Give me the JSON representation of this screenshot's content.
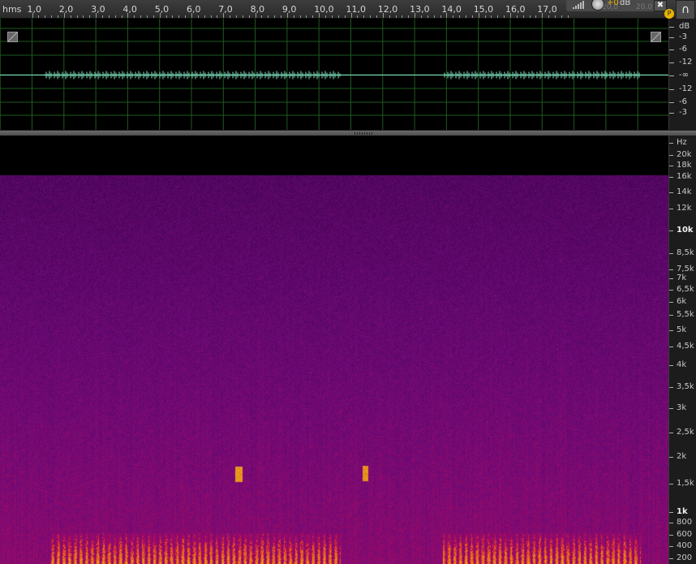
{
  "ruler": {
    "unit": "hms",
    "ticks": [
      "1,0",
      "2,0",
      "3,0",
      "4,0",
      "5,0",
      "6,0",
      "7,0",
      "8,0",
      "9,0",
      "10,0",
      "11,0",
      "12,0",
      "13,0",
      "14,0",
      "15,0",
      "16,0",
      "17,0"
    ]
  },
  "controls": {
    "volume_value": "+0",
    "volume_unit": "dB",
    "ghost_left": "20,0",
    "ghost_right": "20,0",
    "pin_icon": "pin-icon",
    "headphones_icon": "headphones-icon",
    "playhead_label": "P"
  },
  "waveform": {
    "wave_color": "#7fe0c0",
    "grid_color": "#1e5a1e",
    "db_labels": [
      "dB",
      "-3",
      "-6",
      "-12",
      "-∞",
      "-12",
      "-6",
      "-3"
    ]
  },
  "spectrogram": {
    "hz_labels": [
      {
        "text": "Hz",
        "major": false
      },
      {
        "text": "20k",
        "major": false
      },
      {
        "text": "18k",
        "major": false
      },
      {
        "text": "16k",
        "major": false
      },
      {
        "text": "14k",
        "major": false
      },
      {
        "text": "12k",
        "major": false
      },
      {
        "text": "10k",
        "major": true
      },
      {
        "text": "8,5k",
        "major": false
      },
      {
        "text": "7,5k",
        "major": false
      },
      {
        "text": "7k",
        "major": false
      },
      {
        "text": "6,5k",
        "major": false
      },
      {
        "text": "6k",
        "major": false
      },
      {
        "text": "5,5k",
        "major": false
      },
      {
        "text": "5k",
        "major": false
      },
      {
        "text": "4,5k",
        "major": false
      },
      {
        "text": "4k",
        "major": false
      },
      {
        "text": "3,5k",
        "major": false
      },
      {
        "text": "3k",
        "major": false
      },
      {
        "text": "2,5k",
        "major": false
      },
      {
        "text": "2k",
        "major": false
      },
      {
        "text": "1,5k",
        "major": false
      },
      {
        "text": "1k",
        "major": true
      },
      {
        "text": "800",
        "major": false
      },
      {
        "text": "600",
        "major": false
      },
      {
        "text": "400",
        "major": false
      },
      {
        "text": "200",
        "major": false
      }
    ]
  }
}
